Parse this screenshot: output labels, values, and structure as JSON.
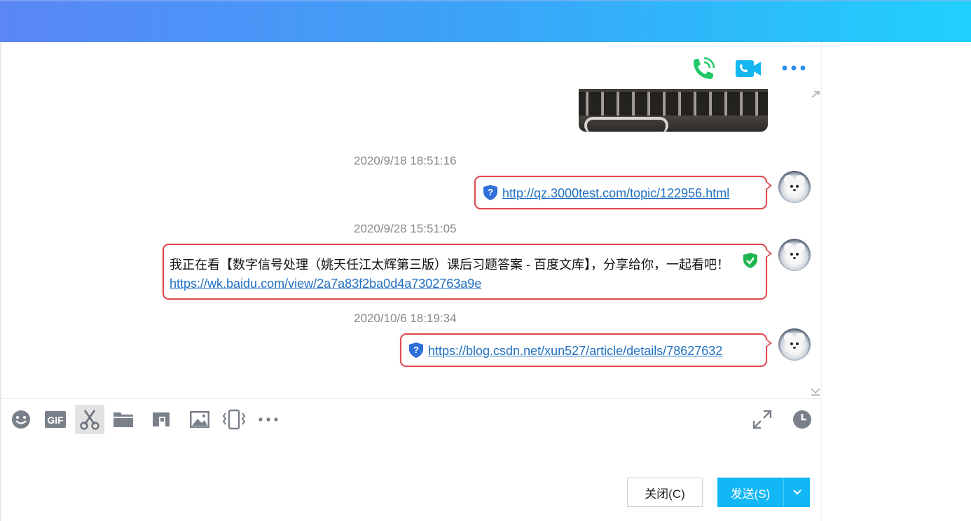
{
  "window": {
    "colors": {
      "titlebar_start": "#5a86f6",
      "titlebar_end": "#20d0fc",
      "bubble_border": "#e0494f",
      "link": "#1f6fc2",
      "send_button": "#12b7f5"
    }
  },
  "header_actions": [
    {
      "name": "voice-call",
      "icon": "phone-icon"
    },
    {
      "name": "video-call",
      "icon": "video-camera-icon"
    },
    {
      "name": "more",
      "icon": "more-dots-icon"
    }
  ],
  "messages": [
    {
      "timestamp": "2020/9/18 18:51:16",
      "link": "http://qz.3000test.com/topic/122956.html",
      "safety_icon": "unknown-shield-icon"
    },
    {
      "timestamp": "2020/9/28 15:51:05",
      "text": "我正在看【数字信号处理（姚天任江太辉第三版）课后习题答案 - 百度文库】，分享给你，一起看吧！",
      "link": "https://wk.baidu.com/view/2a7a83f2ba0d4a7302763a9e",
      "safety_icon": "safe-shield-icon"
    },
    {
      "timestamp": "2020/10/6 18:19:34",
      "link": "https://blog.csdn.net/xun527/article/details/78627632",
      "safety_icon": "unknown-shield-icon"
    }
  ],
  "toolbar": {
    "items": [
      {
        "icon": "emoji-icon"
      },
      {
        "icon": "gif-icon",
        "label": "GIF"
      },
      {
        "icon": "scissors-icon",
        "active": true
      },
      {
        "icon": "folder-icon"
      },
      {
        "icon": "music-note-icon"
      },
      {
        "icon": "image-icon"
      },
      {
        "icon": "shake-icon"
      },
      {
        "icon": "more-dots-icon"
      }
    ],
    "right_items": [
      {
        "icon": "expand-icon"
      },
      {
        "icon": "clock-icon"
      }
    ]
  },
  "buttons": {
    "close_label": "关闭(C)",
    "send_label": "发送(S)"
  }
}
